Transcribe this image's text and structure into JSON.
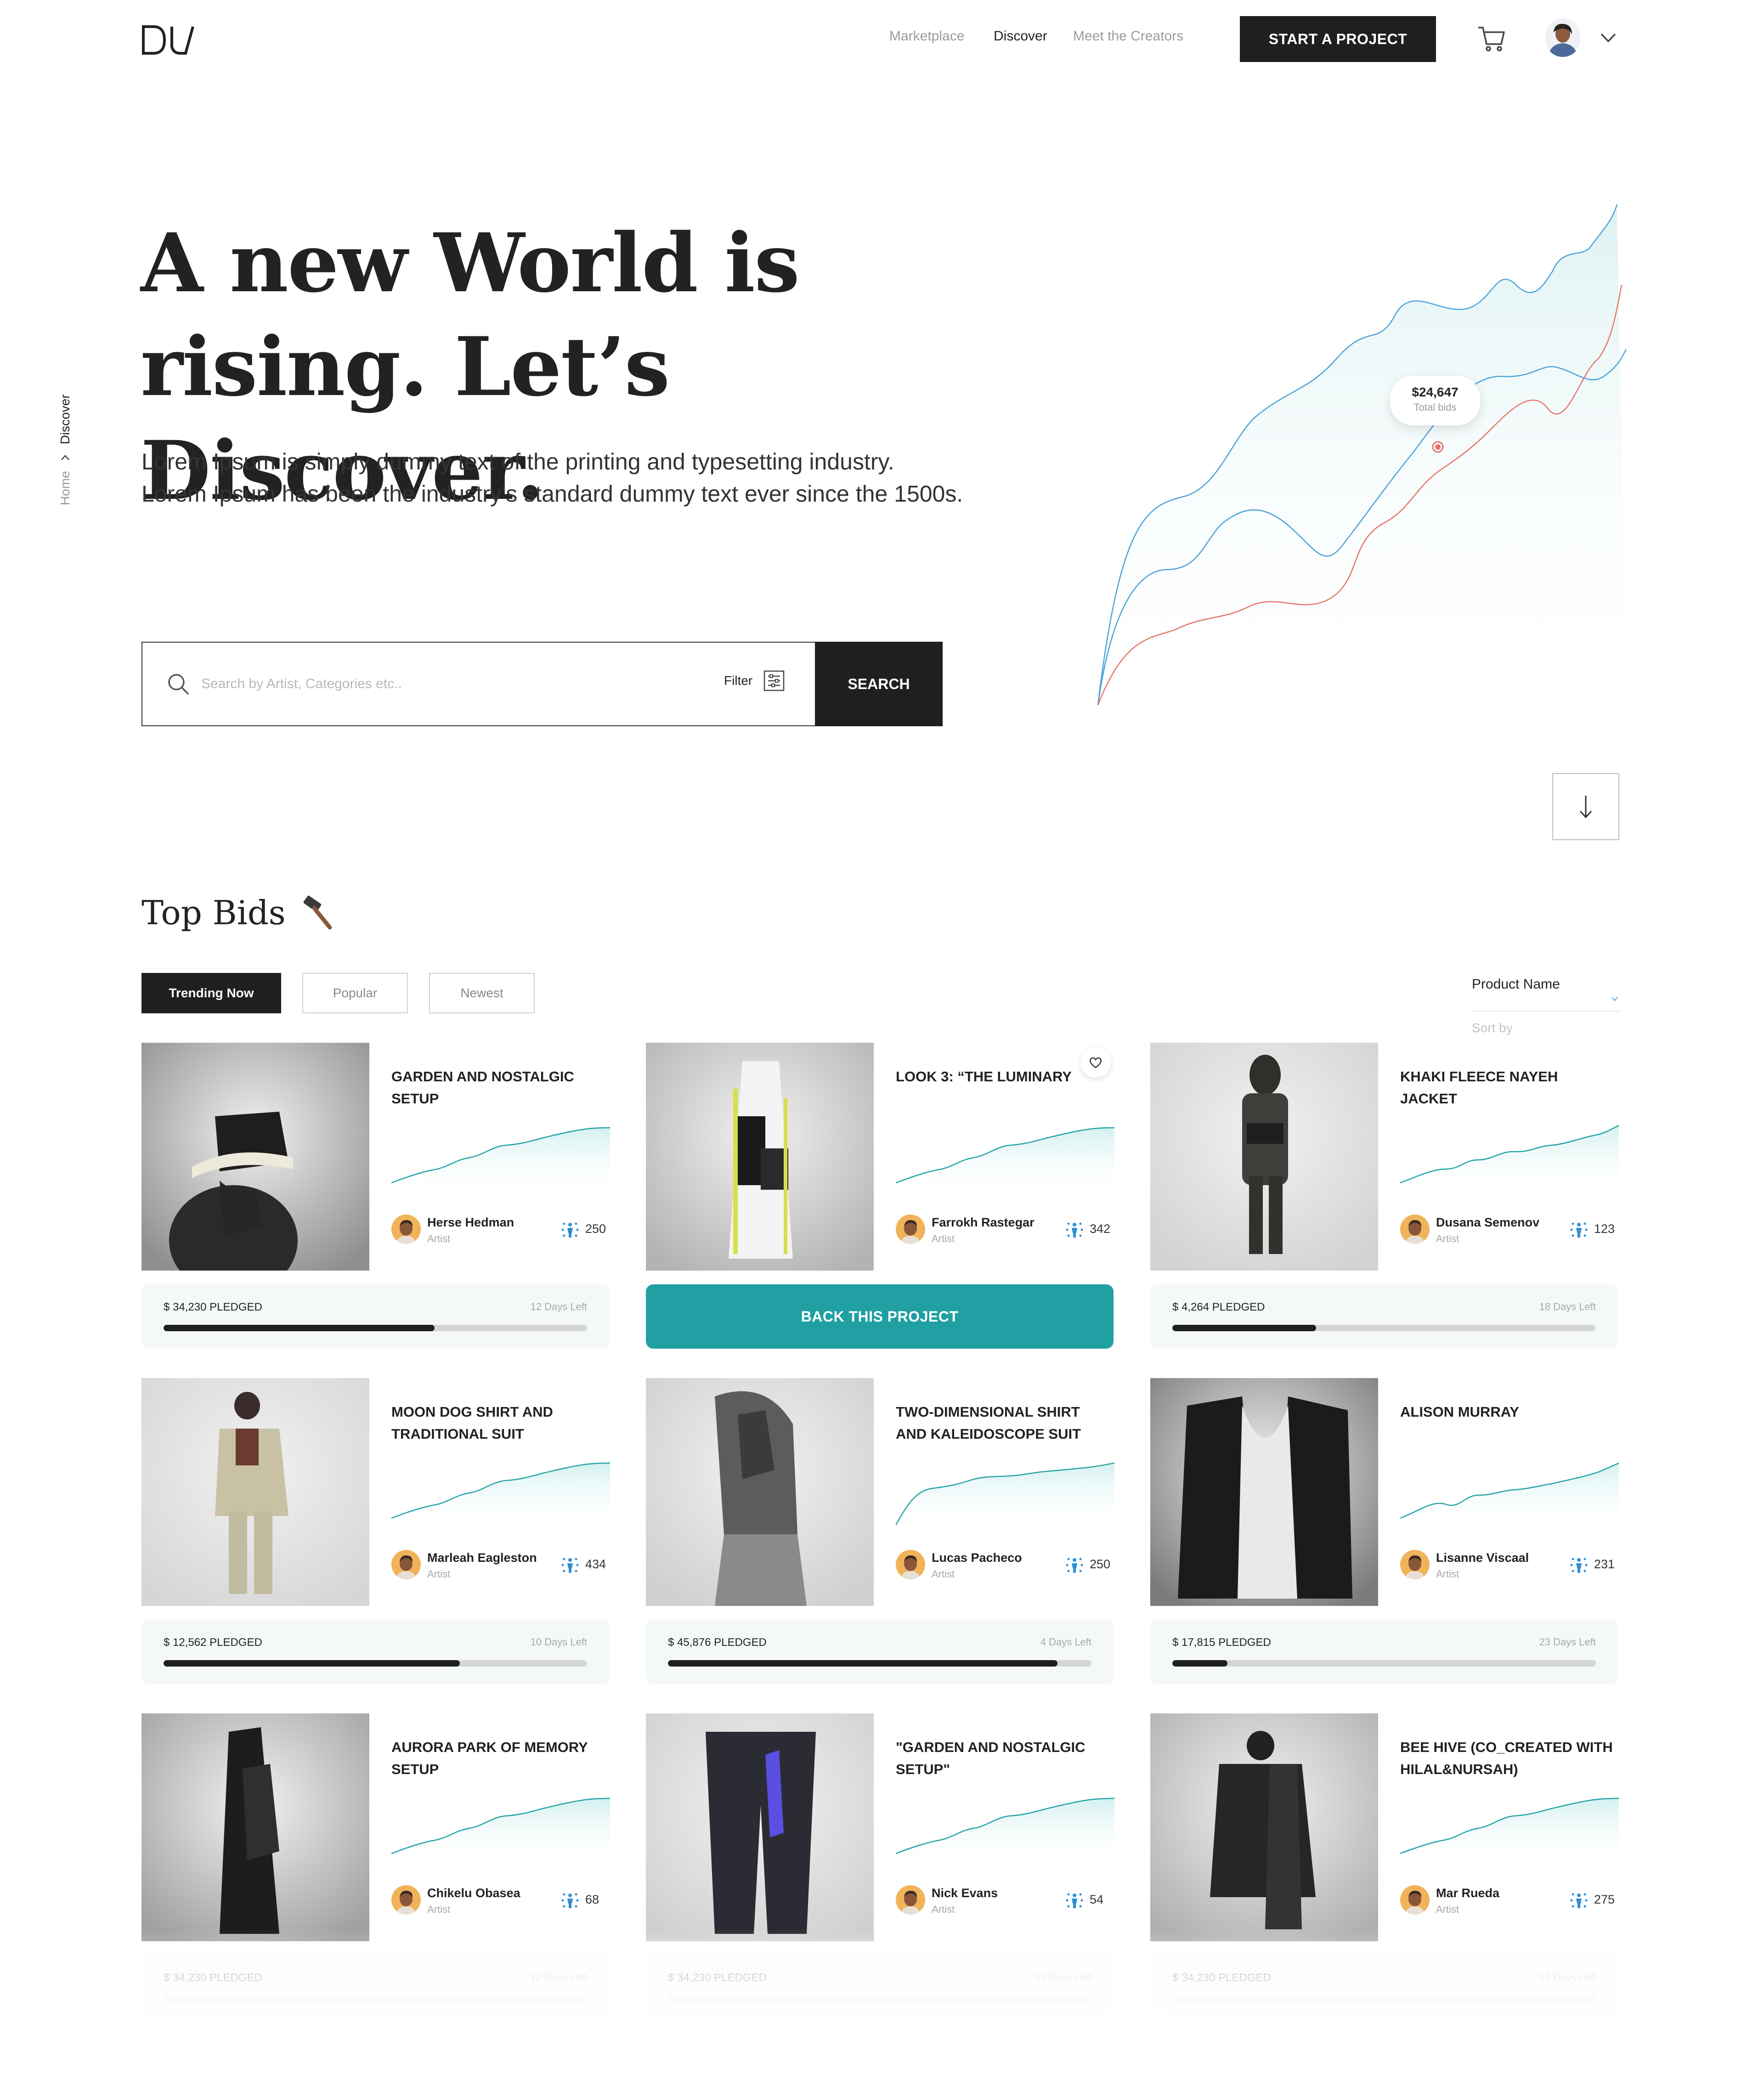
{
  "header": {
    "logo_text": "DV",
    "nav": [
      "Marketplace",
      "Discover",
      "Meet the Creators"
    ],
    "active_nav": "Discover",
    "cta_label": "START A PROJECT",
    "icons": [
      "cart-icon",
      "avatar",
      "chevron-down-icon"
    ]
  },
  "breadcrumb": {
    "home": "Home",
    "current": "Discover"
  },
  "hero": {
    "title_line1": "A new World is",
    "title_line2": "rising. Let’s Discover.",
    "sub_line1": "Lorem Ipsum is simply dummy text of the printing and typesetting industry.",
    "sub_line2": "Lorem Ipsum has been the industry's standard dummy text ever since the 1500s."
  },
  "search": {
    "placeholder": "Search by Artist, Categories etc..",
    "filter_label": "Filter",
    "button_label": "SEARCH"
  },
  "chart_data": {
    "type": "line",
    "series": [
      {},
      {},
      {}
    ],
    "tooltip_value": "$24,647",
    "tooltip_label": "Total bids",
    "colors": [
      "#4aa3d9",
      "#4aa3d9",
      "#e8736a"
    ]
  },
  "top_bids": {
    "title": "Top Bids",
    "tabs": [
      "Trending Now",
      "Popular",
      "Newest"
    ],
    "active_tab": "Trending Now",
    "sort": {
      "label": "Product Name",
      "placeholder": "Sort by"
    },
    "back_label": "BACK THIS PROJECT",
    "artist_role": "Artist",
    "cards": [
      {
        "title": "GARDEN AND NOSTALGIC SETUP",
        "artist": "Herse Hedman",
        "bids": "250",
        "pledged": "$ 34,230 PLEDGED",
        "days_left": "12 Days Left",
        "progress": 0.64
      },
      {
        "title": "LOOK 3: “THE LUMINARY",
        "artist": "Farrokh Rastegar",
        "bids": "342",
        "pledged": "",
        "days_left": "",
        "progress": 0
      },
      {
        "title": "KHAKI FLEECE NAYEH JACKET",
        "artist": "Dusana Semenov",
        "bids": "123",
        "pledged": "$ 4,264 PLEDGED",
        "days_left": "18 Days Left",
        "progress": 0.34
      },
      {
        "title": "MOON DOG SHIRT AND TRADITIONAL SUIT",
        "artist": "Marleah Eagleston",
        "bids": "434",
        "pledged": "$ 12,562 PLEDGED",
        "days_left": "10 Days Left",
        "progress": 0.7
      },
      {
        "title": "TWO-DIMENSIONAL SHIRT AND KALEIDOSCOPE SUIT",
        "artist": "Lucas Pacheco",
        "bids": "250",
        "pledged": "$ 45,876 PLEDGED",
        "days_left": "4 Days Left",
        "progress": 0.92
      },
      {
        "title": "ALISON MURRAY",
        "artist": "Lisanne Viscaal",
        "bids": "231",
        "pledged": "$ 17,815 PLEDGED",
        "days_left": "23 Days Left",
        "progress": 0.13
      },
      {
        "title": "AURORA PARK OF MEMORY SETUP",
        "artist": "Chikelu Obasea",
        "bids": "68",
        "pledged": "$ 34,230 PLEDGED",
        "days_left": "12 Days Left",
        "progress": 0
      },
      {
        "title": "\"GARDEN AND NOSTALGIC SETUP\"",
        "artist": "Nick Evans",
        "bids": "54",
        "pledged": "$ 34,230 PLEDGED",
        "days_left": "12 Days Left",
        "progress": 0
      },
      {
        "title": "BEE HIVE (CO_CREATED WITH HILAL&NURSAH)",
        "artist": "Mar Rueda",
        "bids": "275",
        "pledged": "$ 34,230 PLEDGED",
        "days_left": "17 Days Left",
        "progress": 0
      }
    ]
  }
}
